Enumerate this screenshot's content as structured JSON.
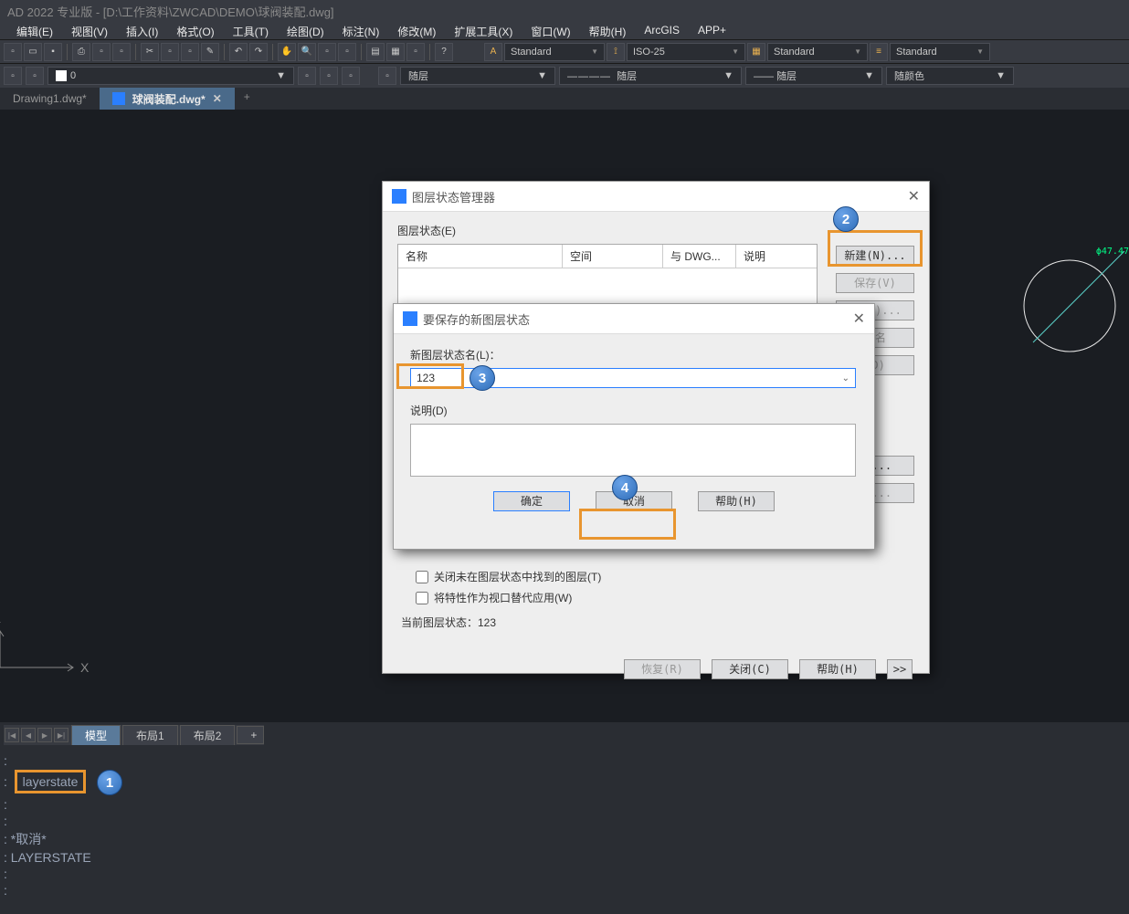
{
  "title": "AD 2022 专业版 - [D:\\工作资料\\ZWCAD\\DEMO\\球阀装配.dwg]",
  "menu": {
    "edit": "编辑(E)",
    "view": "视图(V)",
    "insert": "插入(I)",
    "format": "格式(O)",
    "tool": "工具(T)",
    "draw": "绘图(D)",
    "dim": "标注(N)",
    "modify": "修改(M)",
    "ext": "扩展工具(X)",
    "window": "窗口(W)",
    "help": "帮助(H)",
    "arcgis": "ArcGIS",
    "app": "APP+"
  },
  "styles": {
    "text": "Standard",
    "dim": "ISO-25",
    "table": "Standard",
    "mls": "Standard"
  },
  "layer": {
    "name": "0",
    "current": "随层",
    "lt": "随层",
    "lw": "随层",
    "color": "随颜色"
  },
  "tabs": {
    "t1": "Drawing1.dwg*",
    "t2": "球阀装配.dwg*"
  },
  "drawing": {
    "dim": "ϕ47.47"
  },
  "layout": {
    "model": "模型",
    "l1": "布局1",
    "l2": "布局2",
    "add": "+"
  },
  "cmd": {
    "typed": "layerstate",
    "cancel": "*取消*",
    "last": "LAYERSTATE"
  },
  "dlg1": {
    "title": "图层状态管理器",
    "states_label": "图层状态(E)",
    "col_name": "名称",
    "col_space": "空间",
    "col_dwg": "与 DWG...",
    "col_desc": "说明",
    "btn_new": "新建(N)...",
    "btn_save": "保存(V)",
    "btn_edit": "I (I)...",
    "btn_rename": "命名",
    "btn_del": "(D)",
    "btn_import": "M ...",
    "btn_export": "X ...",
    "chk1": "关闭未在图层状态中找到的图层(T)",
    "chk2": "将特性作为视口替代应用(W)",
    "status": "当前图层状态：123",
    "btn_restore": "恢复(R)",
    "btn_close": "关闭(C)",
    "btn_help": "帮助(H)",
    "btn_expand": ">>"
  },
  "dlg2": {
    "title": "要保存的新图层状态",
    "name_label": "新图层状态名(L)：",
    "name_value": "123",
    "desc_label": "说明(D)",
    "btn_ok": "确定",
    "btn_cancel": "取消",
    "btn_help": "帮助(H)"
  },
  "anno": {
    "c1": "1",
    "c2": "2",
    "c3": "3",
    "c4": "4"
  }
}
